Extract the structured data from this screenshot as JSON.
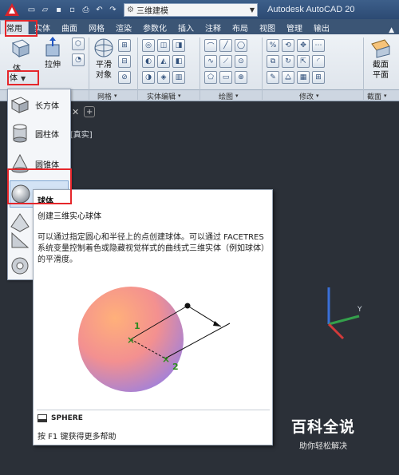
{
  "titlebar": {
    "workspace": "三维建模",
    "app_title": "Autodesk AutoCAD 20"
  },
  "tabs": [
    "常用",
    "实体",
    "曲面",
    "网格",
    "渲染",
    "参数化",
    "插入",
    "注释",
    "布局",
    "视图",
    "管理",
    "输出"
  ],
  "ribbon": {
    "box_label": "长方体",
    "box_short": "体",
    "extrude_label": "拉伸",
    "section_label_line1": "平滑",
    "section_label_line2": "对象",
    "cut_label_line1": "截面",
    "cut_label_line2": "平面",
    "panels": {
      "mesh": "网格",
      "solid_edit": "实体编辑",
      "draw": "绘图",
      "modify": "修改",
      "section": "截面"
    }
  },
  "canvas": {
    "viewport_label": "][真实]"
  },
  "dropdown": {
    "items": [
      "长方体",
      "圆柱体",
      "圆锥体",
      "球体"
    ]
  },
  "tooltip": {
    "title": "球体",
    "description": "创建三维实心球体",
    "body": "可以通过指定圆心和半径上的点创建球体。可以通过 FACETRES 系统变量控制着色或隐藏视觉样式的曲线式三维实体（例如球体）的平滑度。",
    "point1": "1",
    "point2": "2",
    "command": "SPHERE",
    "help": "按 F1 键获得更多帮助"
  },
  "watermark": {
    "main": "百科全说",
    "sub": "助你轻松解决"
  },
  "colors": {
    "accent_red": "#e5262b",
    "ribbon_blue": "#3b5575",
    "canvas": "#2b3038"
  }
}
